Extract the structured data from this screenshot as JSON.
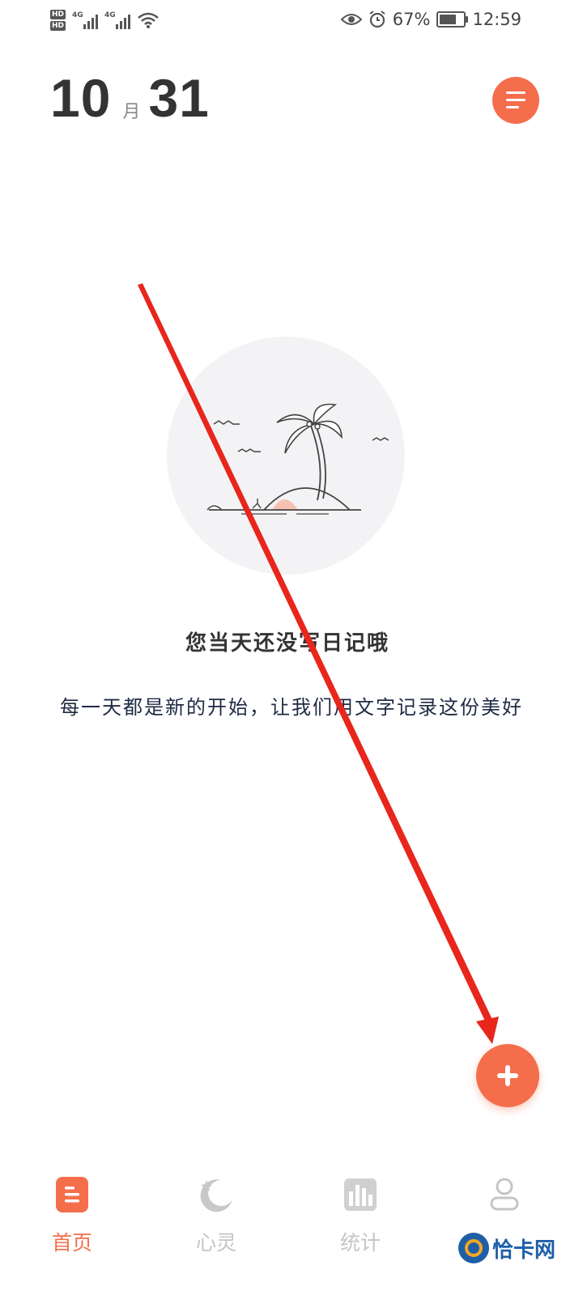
{
  "status_bar": {
    "hd_1": "HD",
    "hd_2": "HD",
    "net_1": "4G",
    "net_2": "4G",
    "battery": "67%",
    "time": "12:59"
  },
  "header": {
    "month": "10",
    "month_unit": "月",
    "day": "31"
  },
  "empty_state": {
    "title": "您当天还没写日记哦",
    "subtitle": "每一天都是新的开始，让我们用文字记录这份美好"
  },
  "bottom_nav": {
    "items": [
      {
        "label": "首页",
        "icon": "diary-icon",
        "active": true
      },
      {
        "label": "心灵",
        "icon": "moon-star-icon",
        "active": false
      },
      {
        "label": "统计",
        "icon": "bar-chart-icon",
        "active": false
      },
      {
        "label": "",
        "icon": "profile-icon",
        "active": false
      }
    ]
  },
  "watermark": {
    "text": "恰卡网"
  },
  "colors": {
    "accent": "#f46e4c",
    "annotation": "#e8261c"
  }
}
